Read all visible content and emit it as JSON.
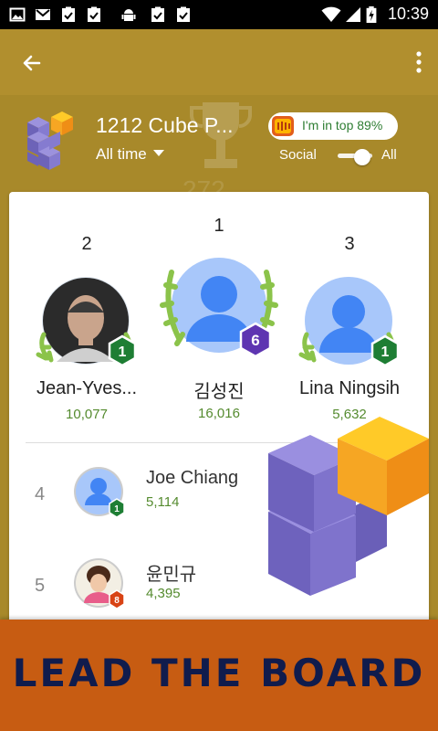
{
  "status_bar": {
    "time": "10:39",
    "left_icons": [
      "image-icon",
      "gmail-icon",
      "task-check-icon",
      "task-check-icon",
      "android-icon",
      "task-check-icon",
      "task-check-icon"
    ],
    "right_icons": [
      "wifi-icon",
      "cellular-icon",
      "battery-charging-icon"
    ]
  },
  "app_bar": {
    "back_icon": "arrow-left-icon",
    "menu_icon": "more-vert-icon"
  },
  "header": {
    "game_title": "1212 Cube P...",
    "timespan_label": "All time",
    "top_badge_text": "I'm in top 89%",
    "toggle_left_label": "Social",
    "toggle_right_label": "All",
    "toggle_state": "All",
    "watermark_number": "272"
  },
  "podium": [
    {
      "rank": "2",
      "name": "Jean-Yves...",
      "score": "10,077",
      "level": "1",
      "level_color": "#1e7e34",
      "avatar": "photo"
    },
    {
      "rank": "1",
      "name": "김성진",
      "score": "16,016",
      "level": "6",
      "level_color": "#5e35b1",
      "avatar": "default"
    },
    {
      "rank": "3",
      "name": "Lina Ningsih",
      "score": "5,632",
      "level": "1",
      "level_color": "#1e7e34",
      "avatar": "default"
    }
  ],
  "rows": [
    {
      "rank": "4",
      "name": "Joe Chiang",
      "score": "5,114",
      "level": "1",
      "level_color": "#1e7e34"
    },
    {
      "rank": "5",
      "name": "윤민규",
      "score": "4,395",
      "level": "8",
      "level_color": "#d84315"
    }
  ],
  "banner": {
    "text": "LEAD THE BOARD"
  },
  "colors": {
    "app_bar": "#b18f2e",
    "header_bg": "#a8892a",
    "score_green": "#558b2f",
    "banner_bg": "#c75c12",
    "banner_text": "#101c4d",
    "cube_purple": "#7b6fc7",
    "cube_orange": "#f6a623"
  }
}
